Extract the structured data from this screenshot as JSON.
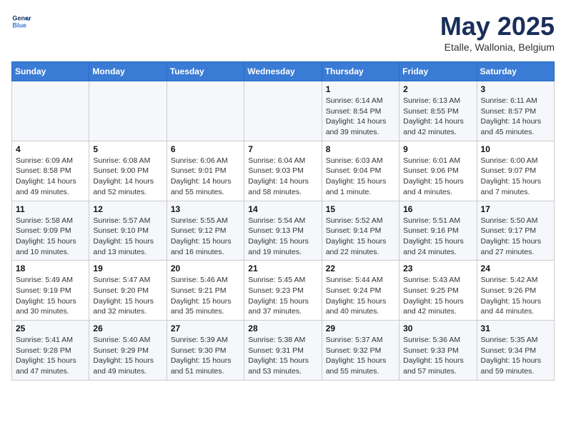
{
  "header": {
    "logo_line1": "General",
    "logo_line2": "Blue",
    "month": "May 2025",
    "location": "Etalle, Wallonia, Belgium"
  },
  "days_of_week": [
    "Sunday",
    "Monday",
    "Tuesday",
    "Wednesday",
    "Thursday",
    "Friday",
    "Saturday"
  ],
  "weeks": [
    [
      {
        "day": "",
        "info": ""
      },
      {
        "day": "",
        "info": ""
      },
      {
        "day": "",
        "info": ""
      },
      {
        "day": "",
        "info": ""
      },
      {
        "day": "1",
        "info": "Sunrise: 6:14 AM\nSunset: 8:54 PM\nDaylight: 14 hours and 39 minutes."
      },
      {
        "day": "2",
        "info": "Sunrise: 6:13 AM\nSunset: 8:55 PM\nDaylight: 14 hours and 42 minutes."
      },
      {
        "day": "3",
        "info": "Sunrise: 6:11 AM\nSunset: 8:57 PM\nDaylight: 14 hours and 45 minutes."
      }
    ],
    [
      {
        "day": "4",
        "info": "Sunrise: 6:09 AM\nSunset: 8:58 PM\nDaylight: 14 hours and 49 minutes."
      },
      {
        "day": "5",
        "info": "Sunrise: 6:08 AM\nSunset: 9:00 PM\nDaylight: 14 hours and 52 minutes."
      },
      {
        "day": "6",
        "info": "Sunrise: 6:06 AM\nSunset: 9:01 PM\nDaylight: 14 hours and 55 minutes."
      },
      {
        "day": "7",
        "info": "Sunrise: 6:04 AM\nSunset: 9:03 PM\nDaylight: 14 hours and 58 minutes."
      },
      {
        "day": "8",
        "info": "Sunrise: 6:03 AM\nSunset: 9:04 PM\nDaylight: 15 hours and 1 minute."
      },
      {
        "day": "9",
        "info": "Sunrise: 6:01 AM\nSunset: 9:06 PM\nDaylight: 15 hours and 4 minutes."
      },
      {
        "day": "10",
        "info": "Sunrise: 6:00 AM\nSunset: 9:07 PM\nDaylight: 15 hours and 7 minutes."
      }
    ],
    [
      {
        "day": "11",
        "info": "Sunrise: 5:58 AM\nSunset: 9:09 PM\nDaylight: 15 hours and 10 minutes."
      },
      {
        "day": "12",
        "info": "Sunrise: 5:57 AM\nSunset: 9:10 PM\nDaylight: 15 hours and 13 minutes."
      },
      {
        "day": "13",
        "info": "Sunrise: 5:55 AM\nSunset: 9:12 PM\nDaylight: 15 hours and 16 minutes."
      },
      {
        "day": "14",
        "info": "Sunrise: 5:54 AM\nSunset: 9:13 PM\nDaylight: 15 hours and 19 minutes."
      },
      {
        "day": "15",
        "info": "Sunrise: 5:52 AM\nSunset: 9:14 PM\nDaylight: 15 hours and 22 minutes."
      },
      {
        "day": "16",
        "info": "Sunrise: 5:51 AM\nSunset: 9:16 PM\nDaylight: 15 hours and 24 minutes."
      },
      {
        "day": "17",
        "info": "Sunrise: 5:50 AM\nSunset: 9:17 PM\nDaylight: 15 hours and 27 minutes."
      }
    ],
    [
      {
        "day": "18",
        "info": "Sunrise: 5:49 AM\nSunset: 9:19 PM\nDaylight: 15 hours and 30 minutes."
      },
      {
        "day": "19",
        "info": "Sunrise: 5:47 AM\nSunset: 9:20 PM\nDaylight: 15 hours and 32 minutes."
      },
      {
        "day": "20",
        "info": "Sunrise: 5:46 AM\nSunset: 9:21 PM\nDaylight: 15 hours and 35 minutes."
      },
      {
        "day": "21",
        "info": "Sunrise: 5:45 AM\nSunset: 9:23 PM\nDaylight: 15 hours and 37 minutes."
      },
      {
        "day": "22",
        "info": "Sunrise: 5:44 AM\nSunset: 9:24 PM\nDaylight: 15 hours and 40 minutes."
      },
      {
        "day": "23",
        "info": "Sunrise: 5:43 AM\nSunset: 9:25 PM\nDaylight: 15 hours and 42 minutes."
      },
      {
        "day": "24",
        "info": "Sunrise: 5:42 AM\nSunset: 9:26 PM\nDaylight: 15 hours and 44 minutes."
      }
    ],
    [
      {
        "day": "25",
        "info": "Sunrise: 5:41 AM\nSunset: 9:28 PM\nDaylight: 15 hours and 47 minutes."
      },
      {
        "day": "26",
        "info": "Sunrise: 5:40 AM\nSunset: 9:29 PM\nDaylight: 15 hours and 49 minutes."
      },
      {
        "day": "27",
        "info": "Sunrise: 5:39 AM\nSunset: 9:30 PM\nDaylight: 15 hours and 51 minutes."
      },
      {
        "day": "28",
        "info": "Sunrise: 5:38 AM\nSunset: 9:31 PM\nDaylight: 15 hours and 53 minutes."
      },
      {
        "day": "29",
        "info": "Sunrise: 5:37 AM\nSunset: 9:32 PM\nDaylight: 15 hours and 55 minutes."
      },
      {
        "day": "30",
        "info": "Sunrise: 5:36 AM\nSunset: 9:33 PM\nDaylight: 15 hours and 57 minutes."
      },
      {
        "day": "31",
        "info": "Sunrise: 5:35 AM\nSunset: 9:34 PM\nDaylight: 15 hours and 59 minutes."
      }
    ]
  ]
}
